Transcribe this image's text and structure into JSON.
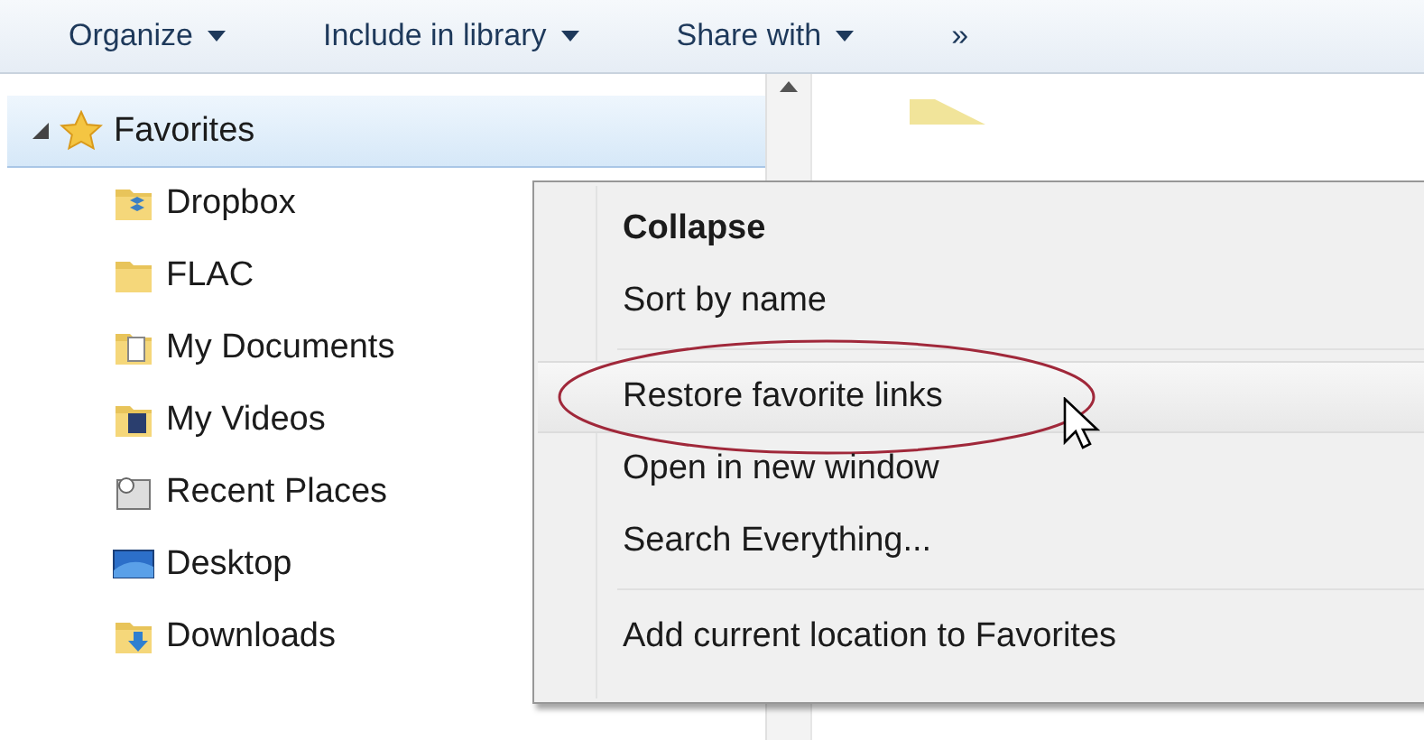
{
  "toolbar": {
    "items": [
      {
        "label": "Organize",
        "kind": "menu"
      },
      {
        "label": "Include in library",
        "kind": "menu"
      },
      {
        "label": "Share with",
        "kind": "menu"
      },
      {
        "label": "»",
        "kind": "more"
      }
    ]
  },
  "tree": {
    "items": [
      {
        "label": "Favorites",
        "kind": "star",
        "expanded": true,
        "selected": true,
        "children": [
          {
            "label": "Dropbox",
            "kind": "dropbox"
          },
          {
            "label": "FLAC",
            "kind": "folder"
          },
          {
            "label": "My Documents",
            "kind": "documents"
          },
          {
            "label": "My Videos",
            "kind": "videos"
          },
          {
            "label": "Recent Places",
            "kind": "recent"
          },
          {
            "label": "Desktop",
            "kind": "desktop"
          },
          {
            "label": "Downloads",
            "kind": "downloads"
          }
        ]
      }
    ]
  },
  "context_menu": {
    "items": [
      {
        "kind": "item",
        "label": "Collapse",
        "default": true,
        "highlighted": false,
        "circled": false
      },
      {
        "kind": "item",
        "label": "Sort by name",
        "default": false,
        "highlighted": false,
        "circled": false
      },
      {
        "kind": "separator"
      },
      {
        "kind": "item",
        "label": "Restore favorite links",
        "default": false,
        "highlighted": true,
        "circled": true
      },
      {
        "kind": "item",
        "label": "Open in new window",
        "default": false,
        "highlighted": false,
        "circled": false
      },
      {
        "kind": "item",
        "label": "Search Everything...",
        "default": false,
        "highlighted": false,
        "circled": false
      },
      {
        "kind": "separator"
      },
      {
        "kind": "item",
        "label": "Add current location to Favorites",
        "default": false,
        "highlighted": false,
        "circled": false
      }
    ]
  }
}
